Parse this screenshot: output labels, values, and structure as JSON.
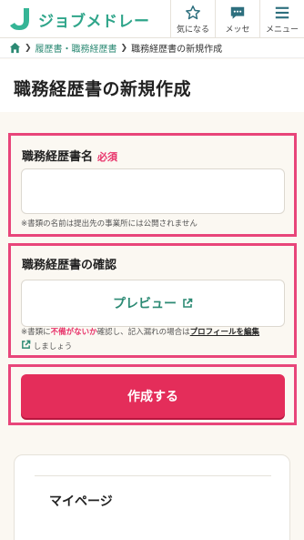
{
  "header": {
    "logo_text": "ジョブメドレー",
    "nav": [
      {
        "label": "気になる",
        "icon": "star-icon"
      },
      {
        "label": "メッセ",
        "icon": "chat-icon"
      },
      {
        "label": "メニュー",
        "icon": "hamburger-icon"
      }
    ]
  },
  "breadcrumb": {
    "items": [
      "履歴書・職務経歴書",
      "職務経歴書の新規作成"
    ]
  },
  "page": {
    "title": "職務経歴書の新規作成"
  },
  "name_section": {
    "label": "職務経歴書名",
    "required": "必須",
    "input_value": "",
    "note": "※書類の名前は提出先の事業所には公開されません"
  },
  "confirm_section": {
    "label": "職務経歴書の確認",
    "preview_label": "プレビュー",
    "note_prefix": "※書類に",
    "note_emphasis": "不備がないか",
    "note_middle": "確認し、記入漏れの場合は",
    "note_link": "プロフィールを編集",
    "note_suffix": "しましょう"
  },
  "create_button": {
    "label": "作成する"
  },
  "card": {
    "item": "マイページ"
  },
  "colors": {
    "brand": "#2fa58a",
    "accent": "#e42d5a",
    "highlight": "#e8457a"
  }
}
